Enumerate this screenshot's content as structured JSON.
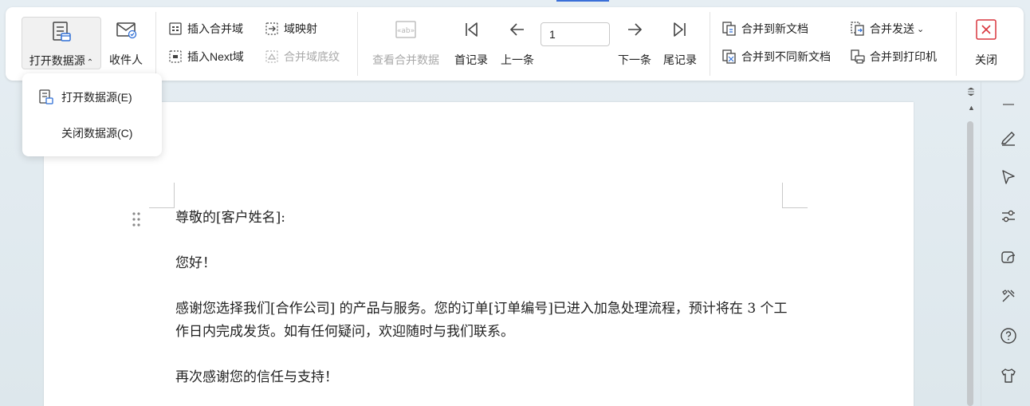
{
  "ribbon": {
    "open_datasource": "打开数据源",
    "recipients": "收件人",
    "insert_merge_field": "插入合并域",
    "field_mapping": "域映射",
    "insert_next_field": "插入Next域",
    "merge_field_shading": "合并域底纹",
    "view_merged_data": "查看合并数据",
    "first_record": "首记录",
    "prev_record": "上一条",
    "record_number": "1",
    "next_record": "下一条",
    "last_record": "尾记录",
    "merge_to_new_doc": "合并到新文档",
    "merge_to_different_docs": "合并到不同新文档",
    "merge_send": "合并发送",
    "merge_to_printer": "合并到打印机",
    "close": "关闭"
  },
  "dropdown": {
    "items": [
      {
        "label": "打开数据源(E)",
        "icon": "datasource-icon"
      },
      {
        "label": "关闭数据源(C)"
      }
    ]
  },
  "document": {
    "paragraphs": [
      "尊敬的[客户姓名]:",
      "您好！",
      "感谢您选择我们[合作公司] 的产品与服务。您的订单[订单编号]已进入加急处理流程，预计将在 3 个工作日内完成发货。如有任何疑问，欢迎随时与我们联系。",
      "再次感谢您的信任与支持！"
    ]
  },
  "colors": {
    "accent": "#3a6fd8",
    "close_red": "#d9363e",
    "disabled": "#a9a9a9"
  },
  "sidebar_icons": [
    "minimize-icon",
    "pen-icon",
    "cursor-icon",
    "sliders-icon",
    "shapes-icon",
    "tools-icon",
    "help-icon",
    "shirt-icon"
  ]
}
